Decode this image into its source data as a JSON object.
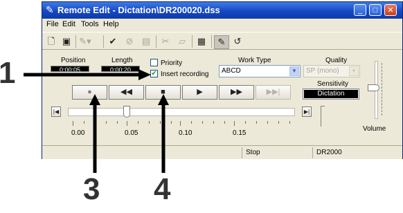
{
  "window": {
    "title": "Remote Edit - Dictation\\DR200020.dss"
  },
  "menu": [
    "File",
    "Edit",
    "Tools",
    "Help"
  ],
  "toolbar_icons": [
    "new-file-icon",
    "save-icon",
    "erase-icon",
    "check-icon",
    "cancel-icon",
    "book-icon",
    "disconnect-icon",
    "folder-icon",
    "properties-icon",
    "options-icon",
    "rewind-icon"
  ],
  "position": {
    "label": "Position",
    "value": "0:00:05"
  },
  "length": {
    "label": "Length",
    "value": "0:00:20"
  },
  "priority": {
    "label": "Priority",
    "checked": false
  },
  "insert_recording": {
    "label": "Insert recording",
    "checked": true
  },
  "work_type": {
    "label": "Work Type",
    "value": "ABCD"
  },
  "quality": {
    "label": "Quality",
    "value": "SP (mono)"
  },
  "sensitivity": {
    "label": "Sensitivity",
    "value": "Dictation"
  },
  "transport": {
    "record": "●",
    "rewind": "◀◀",
    "stop": "■",
    "play": "▶",
    "fast_forward": "▶▶",
    "end": "▶▶|"
  },
  "seek": {
    "start_marker": "|◀",
    "end_marker": "▶|",
    "ticks": [
      "0.00",
      "0.05",
      "0.10",
      "0.15"
    ],
    "position_fraction": 0.25
  },
  "volume": {
    "label": "Volume",
    "level_fraction": 0.5
  },
  "status": {
    "state": "Stop",
    "device": "DR2000"
  },
  "callouts": [
    "1",
    "3",
    "4"
  ]
}
